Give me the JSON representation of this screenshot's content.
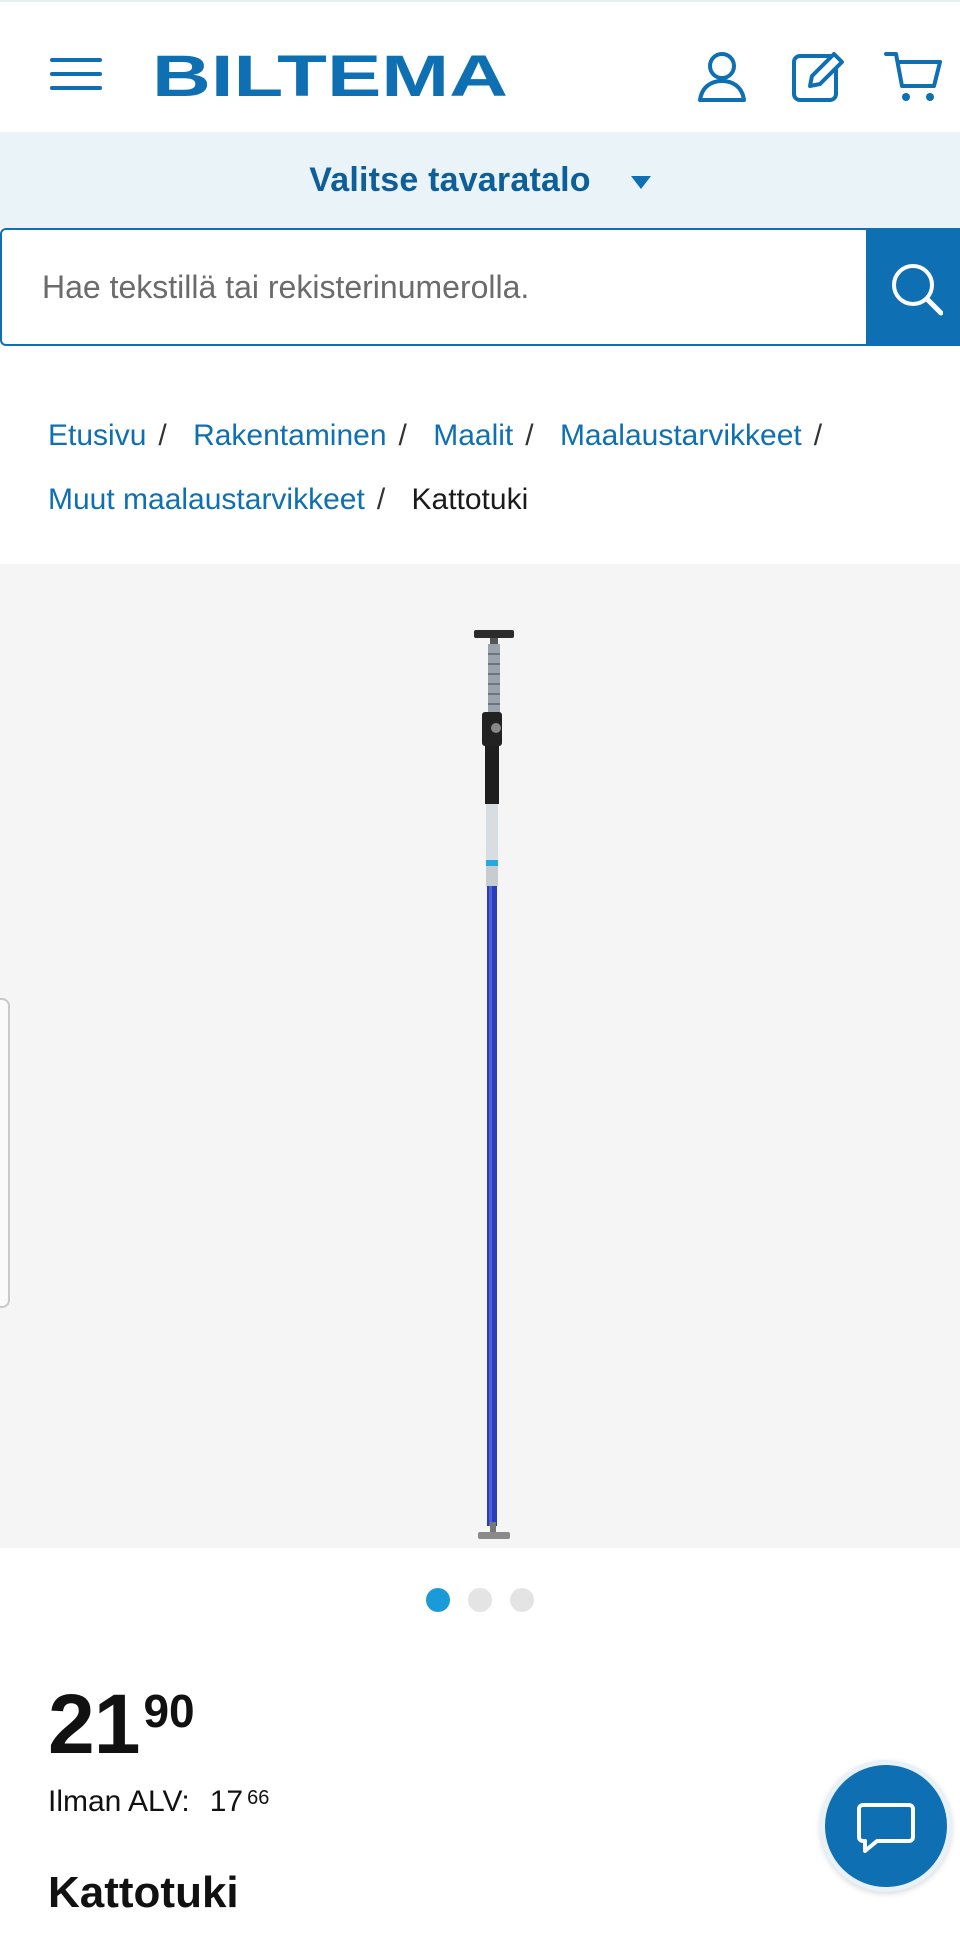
{
  "header": {
    "brand": "BILTEMA",
    "menu_icon": "hamburger-menu-icon",
    "account_icon": "user-icon",
    "notes_icon": "edit-icon",
    "cart_icon": "cart-icon"
  },
  "store_selector": {
    "label": "Valitse tavaratalo"
  },
  "search": {
    "placeholder": "Hae tekstillä tai rekisterinumerolla.",
    "button_icon": "search-icon"
  },
  "breadcrumb": {
    "items": [
      {
        "label": "Etusivu"
      },
      {
        "label": "Rakentaminen"
      },
      {
        "label": "Maalit"
      },
      {
        "label": "Maalaustarvikkeet"
      },
      {
        "label": "Muut maalaustarvikkeet"
      }
    ],
    "separator": "/",
    "current": "Kattotuki"
  },
  "gallery": {
    "image_count": 3,
    "active_index": 0
  },
  "product": {
    "price_main": "21",
    "price_decimals": "90",
    "vat_label": "Ilman ALV:",
    "vat_price_main": "17",
    "vat_price_decimals": "66",
    "title": "Kattotuki"
  },
  "chat": {
    "icon": "chat-icon"
  },
  "colors": {
    "brand_blue": "#0e6fb3",
    "store_bar_bg": "#eaf4f8",
    "active_dot": "#1a9ad6",
    "gallery_bg": "#f5f5f5"
  }
}
